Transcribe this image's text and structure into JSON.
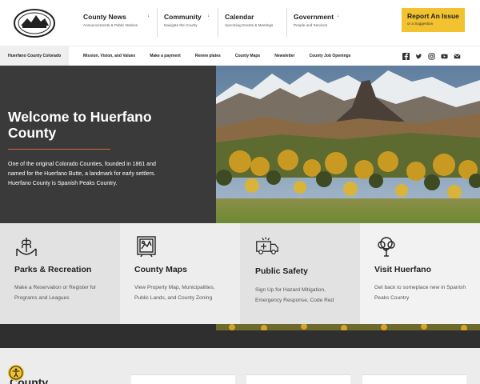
{
  "header": {
    "logo": {
      "icon": "county-seal-icon"
    },
    "nav": [
      {
        "title": "County News",
        "subtitle": "Announcements & Public Notices"
      },
      {
        "title": "Community",
        "subtitle": "Navigate the County"
      },
      {
        "title": "Calendar",
        "subtitle": "Upcoming Events & Meetings"
      },
      {
        "title": "Government",
        "subtitle": "People and Services"
      }
    ],
    "report": {
      "title": "Report An Issue",
      "subtitle": "or a Suggestion"
    }
  },
  "subnav": {
    "home": "Huerfano County Colorado",
    "links": [
      "Mission, Vision, and Values",
      "Make a payment",
      "Renew plates",
      "County Maps",
      "Newsletter",
      "County Job Openings"
    ],
    "social": [
      "facebook-icon",
      "twitter-icon",
      "instagram-icon",
      "youtube-icon",
      "mail-icon"
    ]
  },
  "hero": {
    "title": "Welcome to Huerfano County",
    "text": "One of the original Colorado Counties, founded in 1861 and named for the Huerfano Butte, a landmark for early settlers. Huerfano County is Spanish Peaks Country."
  },
  "cards": [
    {
      "title": "Parks & Recreation",
      "desc": "Make a Reservation or Register for Programs and Leagues",
      "icon": "wheat-hand-icon"
    },
    {
      "title": "County Maps",
      "desc": "View Property Map, Municipalities, Public Lands, and County Zoning",
      "icon": "map-frame-icon"
    },
    {
      "title": "Public Safety",
      "desc": "Sign Up for Hazard Mitigation, Emergency Response, Code Red",
      "icon": "ambulance-icon"
    },
    {
      "title": "Visit Huerfano",
      "desc": "Get back to someplace new in Spanish Peaks Country",
      "icon": "tree-icon"
    }
  ],
  "bottom": {
    "heading": "County"
  },
  "accessibility": {
    "icon": "accessibility-icon"
  },
  "colors": {
    "accent": "#f2c230",
    "hero_bg": "#3a3a3a",
    "rule": "#d66a3c"
  }
}
